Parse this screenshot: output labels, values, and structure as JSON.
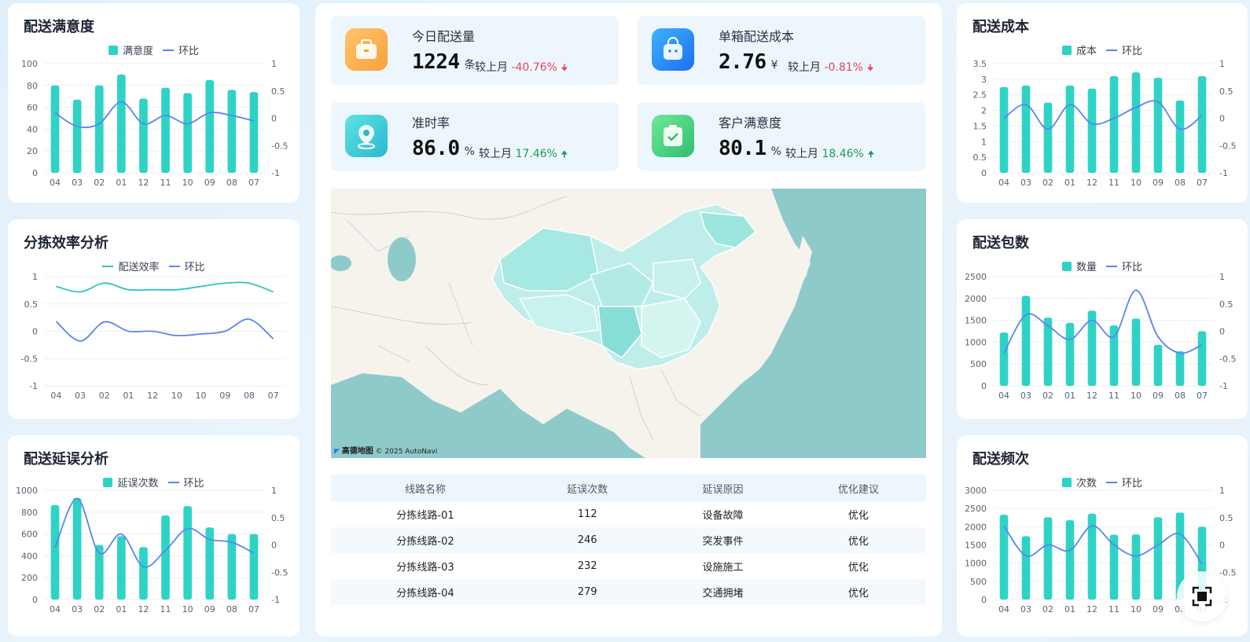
{
  "panels": {
    "satisfaction": {
      "title": "配送满意度",
      "legend_bar": "满意度",
      "legend_line": "环比",
      "categories": [
        "04",
        "03",
        "02",
        "01",
        "12",
        "11",
        "10",
        "09",
        "08",
        "07"
      ],
      "bars": [
        80,
        67,
        80,
        90,
        68,
        78,
        73,
        85,
        76,
        74
      ],
      "line": [
        0.1,
        -0.15,
        -0.1,
        0.3,
        -0.1,
        0.05,
        -0.1,
        0.1,
        0.05,
        -0.05
      ],
      "left_axis": [
        "100",
        "80",
        "60",
        "40",
        "20",
        "0"
      ],
      "left_max": 100,
      "right_axis": [
        "1",
        "0.5",
        "0",
        "-0.5",
        "-1"
      ]
    },
    "sorting": {
      "title": "分拣效率分析",
      "legend_line1": "配送效率",
      "legend_line2": "环比",
      "categories": [
        "04",
        "03",
        "02",
        "01",
        "12",
        "10",
        "10",
        "09",
        "08",
        "07"
      ],
      "line1": [
        0.82,
        0.72,
        0.88,
        0.76,
        0.76,
        0.76,
        0.82,
        0.88,
        0.88,
        0.72
      ],
      "line2": [
        0.18,
        -0.18,
        0.17,
        0.0,
        0.0,
        -0.08,
        -0.05,
        0.0,
        0.22,
        -0.14
      ],
      "axis": [
        "1",
        "0.5",
        "0",
        "-0.5",
        "-1"
      ]
    },
    "delay": {
      "title": "配送延误分析",
      "legend_bar": "延误次数",
      "legend_line": "环比",
      "categories": [
        "04",
        "03",
        "02",
        "01",
        "12",
        "11",
        "10",
        "09",
        "08",
        "07"
      ],
      "bars": [
        865,
        930,
        500,
        580,
        480,
        770,
        855,
        660,
        600,
        600
      ],
      "line": [
        -0.05,
        0.85,
        -0.15,
        0.2,
        -0.4,
        -0.1,
        0.3,
        0.1,
        0.05,
        -0.15
      ],
      "left_axis": [
        "1000",
        "800",
        "600",
        "400",
        "200",
        "0"
      ],
      "left_max": 1000,
      "right_axis": [
        "1",
        "0.5",
        "0",
        "-0.5",
        "-1"
      ]
    },
    "cost": {
      "title": "配送成本",
      "legend_bar": "成本",
      "legend_line": "环比",
      "categories": [
        "04",
        "03",
        "02",
        "01",
        "12",
        "11",
        "10",
        "09",
        "08",
        "07"
      ],
      "bars": [
        2.75,
        2.8,
        2.25,
        2.8,
        2.7,
        3.1,
        3.22,
        3.05,
        2.32,
        3.1
      ],
      "line": [
        0.0,
        0.25,
        -0.2,
        0.25,
        -0.1,
        0.0,
        0.2,
        0.3,
        -0.2,
        0.05
      ],
      "left_axis": [
        "3.5",
        "3",
        "2.5",
        "2",
        "1.5",
        "1",
        "0.5",
        "0"
      ],
      "left_max": 3.5,
      "right_axis": [
        "1",
        "0.5",
        "0",
        "-0.5",
        "-1"
      ]
    },
    "packages": {
      "title": "配送包数",
      "legend_bar": "数量",
      "legend_line": "环比",
      "categories": [
        "04",
        "03",
        "02",
        "01",
        "12",
        "11",
        "10",
        "09",
        "08",
        "07"
      ],
      "bars": [
        1220,
        2060,
        1560,
        1440,
        1720,
        1380,
        1540,
        940,
        790,
        1250
      ],
      "line": [
        -0.4,
        0.3,
        0.1,
        -0.15,
        0.2,
        -0.1,
        0.75,
        -0.1,
        -0.4,
        -0.25
      ],
      "left_axis": [
        "2500",
        "2000",
        "1500",
        "1000",
        "500",
        "0"
      ],
      "left_max": 2500,
      "right_axis": [
        "1",
        "0.5",
        "0",
        "-0.5",
        "-1"
      ]
    },
    "frequency": {
      "title": "配送频次",
      "legend_bar": "次数",
      "legend_line": "环比",
      "categories": [
        "04",
        "03",
        "02",
        "01",
        "12",
        "11",
        "10",
        "09",
        "08",
        "07"
      ],
      "bars": [
        2330,
        1740,
        2260,
        2180,
        2360,
        1780,
        1790,
        2260,
        2390,
        2000
      ],
      "line": [
        0.35,
        -0.2,
        0.0,
        -0.1,
        0.35,
        0.0,
        -0.2,
        0.0,
        0.2,
        -0.35
      ],
      "left_axis": [
        "3000",
        "2500",
        "2000",
        "1500",
        "1000",
        "500",
        "0"
      ],
      "left_max": 3000,
      "right_axis": [
        "1",
        "0.5",
        "0",
        "-0.5",
        "-1"
      ]
    }
  },
  "kpis": [
    {
      "label": "今日配送量",
      "value": "1224",
      "unit": "条",
      "cmp_label": "较上月",
      "cmp_value": "-40.76%",
      "arrow": "🠋",
      "dir": "down"
    },
    {
      "label": "单箱配送成本",
      "value": "2.76",
      "unit": "¥",
      "cmp_label": "较上月",
      "cmp_value": "-0.81%",
      "arrow": "🠋",
      "dir": "down"
    },
    {
      "label": "准时率",
      "value": "86.0",
      "unit": "%",
      "cmp_label": "较上月",
      "cmp_value": "17.46%",
      "arrow": "🠉",
      "dir": "up"
    },
    {
      "label": "客户满意度",
      "value": "80.1",
      "unit": "%",
      "cmp_label": "较上月",
      "cmp_value": "18.46%",
      "arrow": "🠉",
      "dir": "up"
    }
  ],
  "map": {
    "brand": "高德地图",
    "credit": "© 2025 AutoNavi"
  },
  "table": {
    "headers": [
      "线路名称",
      "延误次数",
      "延误原因",
      "优化建议"
    ],
    "rows": [
      [
        "分拣线路-01",
        "112",
        "设备故障",
        "优化"
      ],
      [
        "分拣线路-02",
        "246",
        "突发事件",
        "优化"
      ],
      [
        "分拣线路-03",
        "232",
        "设施施工",
        "优化"
      ],
      [
        "分拣线路-04",
        "279",
        "交通拥堵",
        "优化"
      ]
    ]
  },
  "colors": {
    "bar": "#2ed3c6",
    "line_blue": "#5b84f0",
    "line_teal": "#2cc5b8",
    "down": "#e8455a",
    "up": "#1a9a58"
  }
}
